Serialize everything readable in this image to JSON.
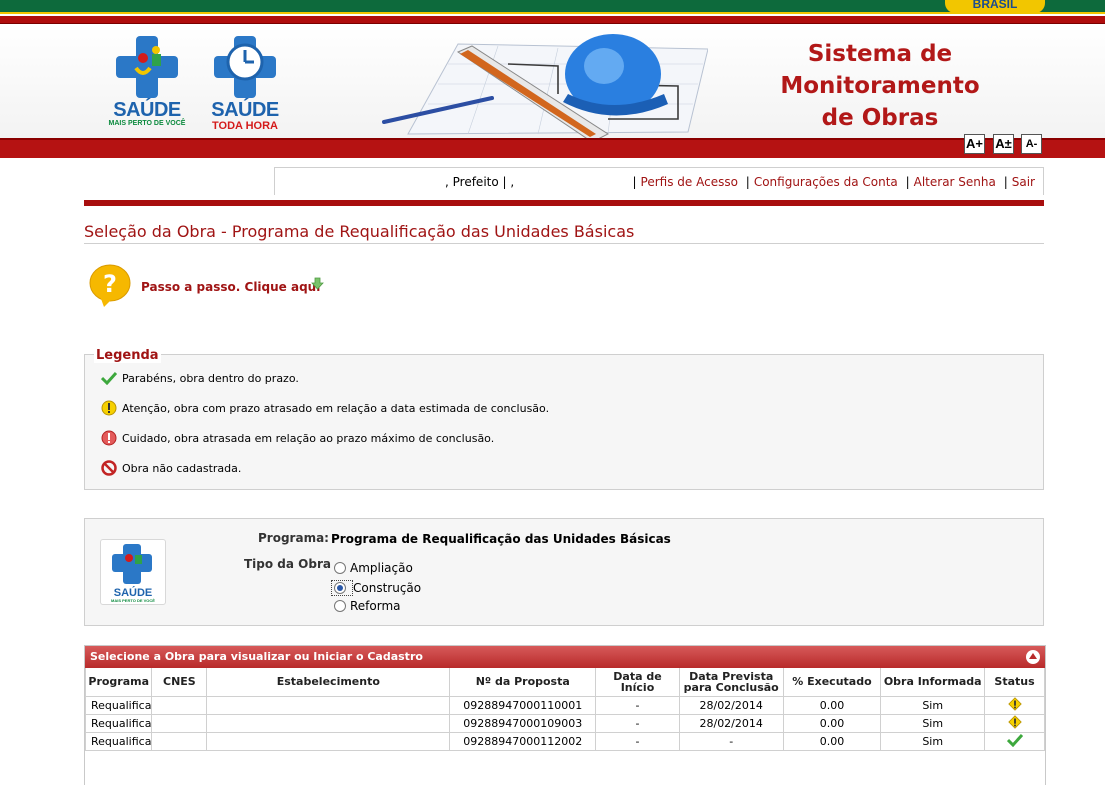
{
  "brasil_label": "BRASIL",
  "logos": [
    {
      "brand": "SAÚDE",
      "slogan": "MAIS PERTO DE VOCÊ"
    },
    {
      "brand": "SAÚDE",
      "slogan": "TODA HORA"
    }
  ],
  "system_title": {
    "line1": "Sistema de",
    "line2": "Monitoramento",
    "line3": "de Obras"
  },
  "font_controls": [
    "A+",
    "A±",
    "A-"
  ],
  "user_menu": {
    "user_text": ", Prefeito | ,",
    "links": [
      "Perfis de Acesso",
      "Configurações da Conta",
      "Alterar Senha",
      "Sair"
    ]
  },
  "page_title": "Seleção da Obra - Programa de Requalificação das Unidades Básicas",
  "help": {
    "text": "Passo a passo.",
    "link": "Clique aqui"
  },
  "legend": {
    "title": "Legenda",
    "items": [
      {
        "icon": "check-icon",
        "text": "Parabéns, obra dentro do prazo."
      },
      {
        "icon": "warning-icon",
        "text": "Atenção, obra com prazo atrasado em relação a data estimada de conclusão."
      },
      {
        "icon": "alert-icon",
        "text": "Cuidado, obra atrasada em relação ao prazo máximo de conclusão."
      },
      {
        "icon": "forbidden-icon",
        "text": "Obra não cadastrada."
      }
    ]
  },
  "program": {
    "label": "Programa:",
    "value": "Programa de Requalificação das Unidades Básicas",
    "type_label": "Tipo da Obra",
    "options": [
      "Ampliação",
      "Construção",
      "Reforma"
    ],
    "selected": "Construção",
    "logo_brand": "SAÚDE",
    "logo_slogan": "MAIS PERTO DE VOCÊ"
  },
  "table": {
    "title": "Selecione a Obra para visualizar ou Iniciar o Cadastro",
    "columns": [
      "Programa",
      "CNES",
      "Estabelecimento",
      "Nº da Proposta",
      "Data de Início",
      "Data Prevista para Conclusão",
      "% Executado",
      "Obra Informada",
      "Status"
    ],
    "rows": [
      {
        "programa": "Requalifica",
        "cnes": "",
        "estabelecimento": "",
        "proposta": "09288947000110001",
        "inicio": "-",
        "prevista": "28/02/2014",
        "executado": "0.00",
        "informada": "Sim",
        "status": "warning-icon"
      },
      {
        "programa": "Requalifica",
        "cnes": "",
        "estabelecimento": "",
        "proposta": "09288947000109003",
        "inicio": "-",
        "prevista": "28/02/2014",
        "executado": "0.00",
        "informada": "Sim",
        "status": "warning-icon"
      },
      {
        "programa": "Requalifica",
        "cnes": "",
        "estabelecimento": "",
        "proposta": "09288947000112002",
        "inicio": "-",
        "prevista": "-",
        "executado": "0.00",
        "informada": "Sim",
        "status": "check-icon"
      }
    ]
  },
  "colors": {
    "brand_red": "#a01414",
    "gov_green": "#0d6a3c",
    "gov_yellow": "#f2c600",
    "brand_blue": "#2b78c7"
  }
}
